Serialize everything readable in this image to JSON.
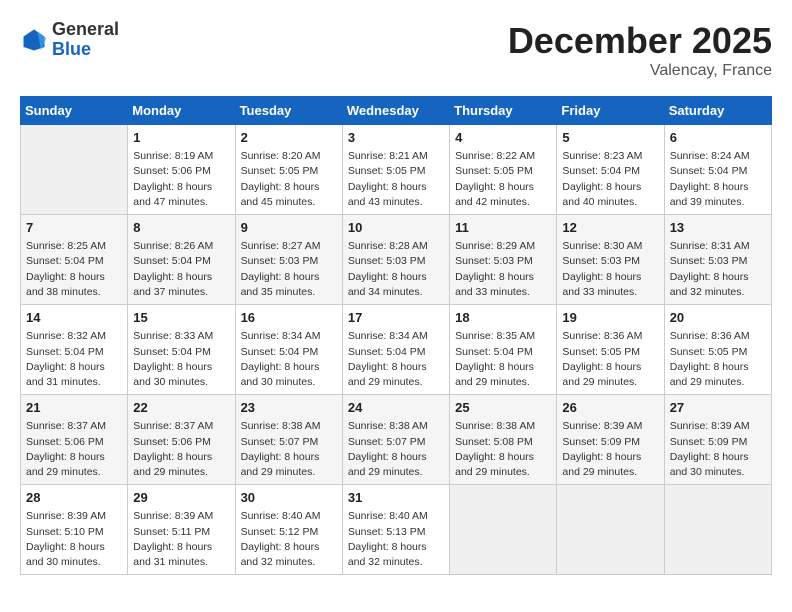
{
  "header": {
    "logo_general": "General",
    "logo_blue": "Blue",
    "month_title": "December 2025",
    "location": "Valencay, France"
  },
  "days_of_week": [
    "Sunday",
    "Monday",
    "Tuesday",
    "Wednesday",
    "Thursday",
    "Friday",
    "Saturday"
  ],
  "weeks": [
    [
      {
        "day": "",
        "empty": true
      },
      {
        "day": "1",
        "sunrise": "Sunrise: 8:19 AM",
        "sunset": "Sunset: 5:06 PM",
        "daylight": "Daylight: 8 hours and 47 minutes."
      },
      {
        "day": "2",
        "sunrise": "Sunrise: 8:20 AM",
        "sunset": "Sunset: 5:05 PM",
        "daylight": "Daylight: 8 hours and 45 minutes."
      },
      {
        "day": "3",
        "sunrise": "Sunrise: 8:21 AM",
        "sunset": "Sunset: 5:05 PM",
        "daylight": "Daylight: 8 hours and 43 minutes."
      },
      {
        "day": "4",
        "sunrise": "Sunrise: 8:22 AM",
        "sunset": "Sunset: 5:05 PM",
        "daylight": "Daylight: 8 hours and 42 minutes."
      },
      {
        "day": "5",
        "sunrise": "Sunrise: 8:23 AM",
        "sunset": "Sunset: 5:04 PM",
        "daylight": "Daylight: 8 hours and 40 minutes."
      },
      {
        "day": "6",
        "sunrise": "Sunrise: 8:24 AM",
        "sunset": "Sunset: 5:04 PM",
        "daylight": "Daylight: 8 hours and 39 minutes."
      }
    ],
    [
      {
        "day": "7",
        "sunrise": "Sunrise: 8:25 AM",
        "sunset": "Sunset: 5:04 PM",
        "daylight": "Daylight: 8 hours and 38 minutes."
      },
      {
        "day": "8",
        "sunrise": "Sunrise: 8:26 AM",
        "sunset": "Sunset: 5:04 PM",
        "daylight": "Daylight: 8 hours and 37 minutes."
      },
      {
        "day": "9",
        "sunrise": "Sunrise: 8:27 AM",
        "sunset": "Sunset: 5:03 PM",
        "daylight": "Daylight: 8 hours and 35 minutes."
      },
      {
        "day": "10",
        "sunrise": "Sunrise: 8:28 AM",
        "sunset": "Sunset: 5:03 PM",
        "daylight": "Daylight: 8 hours and 34 minutes."
      },
      {
        "day": "11",
        "sunrise": "Sunrise: 8:29 AM",
        "sunset": "Sunset: 5:03 PM",
        "daylight": "Daylight: 8 hours and 33 minutes."
      },
      {
        "day": "12",
        "sunrise": "Sunrise: 8:30 AM",
        "sunset": "Sunset: 5:03 PM",
        "daylight": "Daylight: 8 hours and 33 minutes."
      },
      {
        "day": "13",
        "sunrise": "Sunrise: 8:31 AM",
        "sunset": "Sunset: 5:03 PM",
        "daylight": "Daylight: 8 hours and 32 minutes."
      }
    ],
    [
      {
        "day": "14",
        "sunrise": "Sunrise: 8:32 AM",
        "sunset": "Sunset: 5:04 PM",
        "daylight": "Daylight: 8 hours and 31 minutes."
      },
      {
        "day": "15",
        "sunrise": "Sunrise: 8:33 AM",
        "sunset": "Sunset: 5:04 PM",
        "daylight": "Daylight: 8 hours and 30 minutes."
      },
      {
        "day": "16",
        "sunrise": "Sunrise: 8:34 AM",
        "sunset": "Sunset: 5:04 PM",
        "daylight": "Daylight: 8 hours and 30 minutes."
      },
      {
        "day": "17",
        "sunrise": "Sunrise: 8:34 AM",
        "sunset": "Sunset: 5:04 PM",
        "daylight": "Daylight: 8 hours and 29 minutes."
      },
      {
        "day": "18",
        "sunrise": "Sunrise: 8:35 AM",
        "sunset": "Sunset: 5:04 PM",
        "daylight": "Daylight: 8 hours and 29 minutes."
      },
      {
        "day": "19",
        "sunrise": "Sunrise: 8:36 AM",
        "sunset": "Sunset: 5:05 PM",
        "daylight": "Daylight: 8 hours and 29 minutes."
      },
      {
        "day": "20",
        "sunrise": "Sunrise: 8:36 AM",
        "sunset": "Sunset: 5:05 PM",
        "daylight": "Daylight: 8 hours and 29 minutes."
      }
    ],
    [
      {
        "day": "21",
        "sunrise": "Sunrise: 8:37 AM",
        "sunset": "Sunset: 5:06 PM",
        "daylight": "Daylight: 8 hours and 29 minutes."
      },
      {
        "day": "22",
        "sunrise": "Sunrise: 8:37 AM",
        "sunset": "Sunset: 5:06 PM",
        "daylight": "Daylight: 8 hours and 29 minutes."
      },
      {
        "day": "23",
        "sunrise": "Sunrise: 8:38 AM",
        "sunset": "Sunset: 5:07 PM",
        "daylight": "Daylight: 8 hours and 29 minutes."
      },
      {
        "day": "24",
        "sunrise": "Sunrise: 8:38 AM",
        "sunset": "Sunset: 5:07 PM",
        "daylight": "Daylight: 8 hours and 29 minutes."
      },
      {
        "day": "25",
        "sunrise": "Sunrise: 8:38 AM",
        "sunset": "Sunset: 5:08 PM",
        "daylight": "Daylight: 8 hours and 29 minutes."
      },
      {
        "day": "26",
        "sunrise": "Sunrise: 8:39 AM",
        "sunset": "Sunset: 5:09 PM",
        "daylight": "Daylight: 8 hours and 29 minutes."
      },
      {
        "day": "27",
        "sunrise": "Sunrise: 8:39 AM",
        "sunset": "Sunset: 5:09 PM",
        "daylight": "Daylight: 8 hours and 30 minutes."
      }
    ],
    [
      {
        "day": "28",
        "sunrise": "Sunrise: 8:39 AM",
        "sunset": "Sunset: 5:10 PM",
        "daylight": "Daylight: 8 hours and 30 minutes."
      },
      {
        "day": "29",
        "sunrise": "Sunrise: 8:39 AM",
        "sunset": "Sunset: 5:11 PM",
        "daylight": "Daylight: 8 hours and 31 minutes."
      },
      {
        "day": "30",
        "sunrise": "Sunrise: 8:40 AM",
        "sunset": "Sunset: 5:12 PM",
        "daylight": "Daylight: 8 hours and 32 minutes."
      },
      {
        "day": "31",
        "sunrise": "Sunrise: 8:40 AM",
        "sunset": "Sunset: 5:13 PM",
        "daylight": "Daylight: 8 hours and 32 minutes."
      },
      {
        "day": "",
        "empty": true
      },
      {
        "day": "",
        "empty": true
      },
      {
        "day": "",
        "empty": true
      }
    ]
  ]
}
